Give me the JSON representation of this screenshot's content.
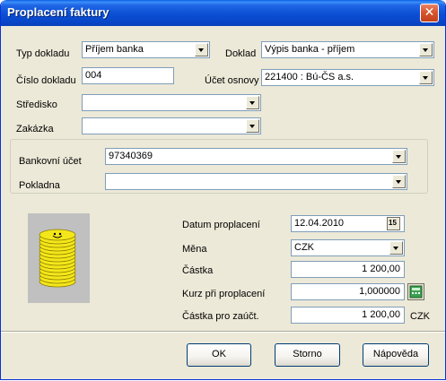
{
  "window": {
    "title": "Proplacení faktury",
    "close_icon": "close-icon"
  },
  "form": {
    "typ_dokladu": {
      "label": "Typ dokladu",
      "value": "Příjem banka"
    },
    "doklad": {
      "label": "Doklad",
      "value": "Výpis banka - příjem"
    },
    "cislo_dokladu": {
      "label": "Číslo dokladu",
      "value": "004"
    },
    "ucet_osnovy": {
      "label": "Účet osnovy",
      "value": "221400 : Bú-ČS a.s."
    },
    "stredisko": {
      "label": "Středisko",
      "value": ""
    },
    "zakazka": {
      "label": "Zakázka",
      "value": ""
    }
  },
  "bank_group": {
    "bankovni_ucet": {
      "label": "Bankovní účet",
      "value": "97340369"
    },
    "pokladna": {
      "label": "Pokladna",
      "value": ""
    }
  },
  "payment": {
    "datum_proplaceni": {
      "label": "Datum proplacení",
      "value": "12.04.2010",
      "icon": "calendar-icon",
      "icon_text": "15"
    },
    "mena": {
      "label": "Měna",
      "value": "CZK"
    },
    "castka": {
      "label": "Částka",
      "value": "1 200,00"
    },
    "kurz": {
      "label": "Kurz při proplacení",
      "value": "1,000000",
      "icon": "calculator-icon"
    },
    "castka_zauct": {
      "label": "Částka pro zaúčt.",
      "value": "1 200,00",
      "currency": "CZK"
    }
  },
  "image": {
    "icon": "coin-stack-icon"
  },
  "buttons": {
    "ok": "OK",
    "storno": "Storno",
    "napoveda": "Nápověda"
  }
}
